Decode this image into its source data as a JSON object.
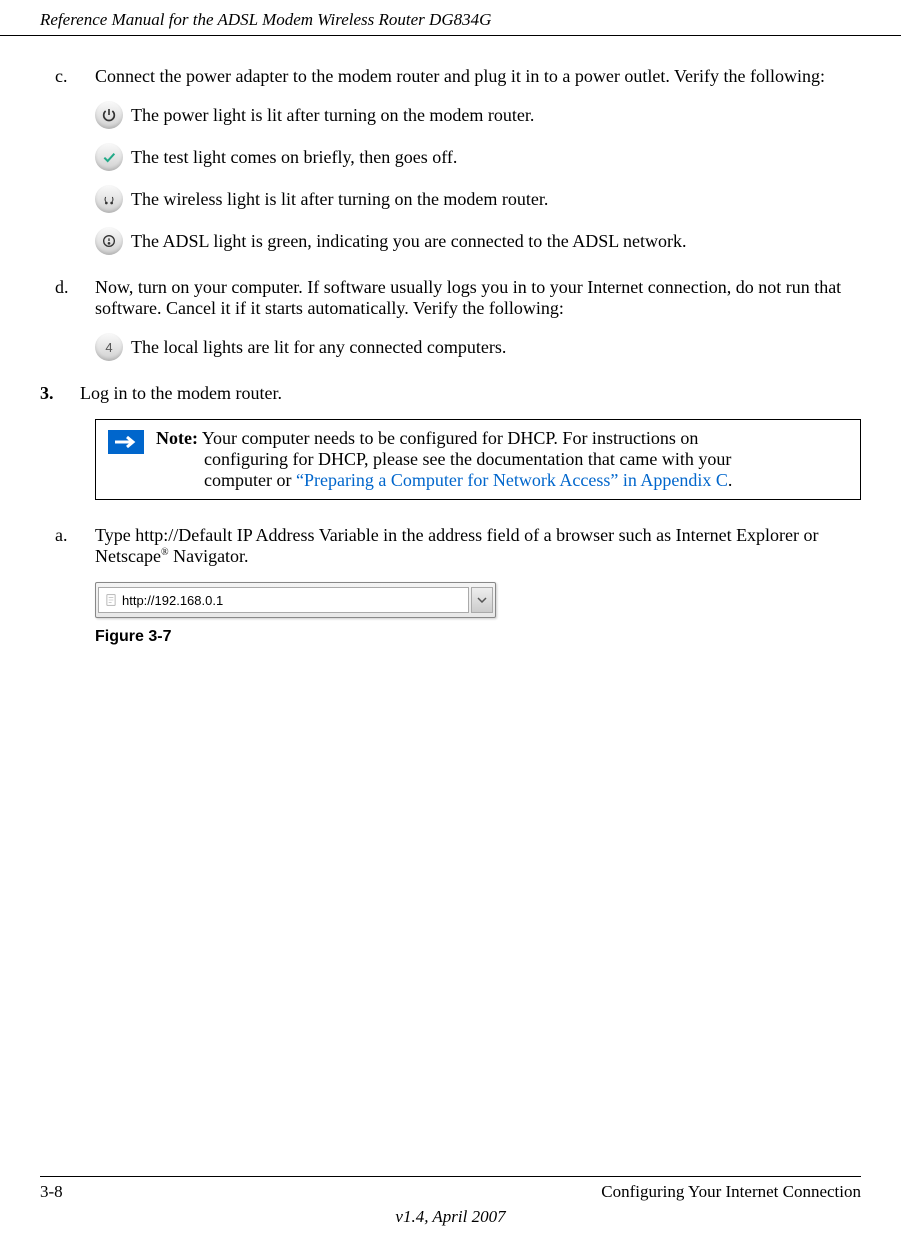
{
  "header": {
    "title": "Reference Manual for the ADSL Modem Wireless Router DG834G"
  },
  "item_c": {
    "marker": "c.",
    "text": "Connect the power adapter to the modem router and plug it in to a power outlet. Verify the following:",
    "bullets": [
      " The power light is lit after turning on the modem router.",
      " The test light comes on briefly, then goes off.",
      " The wireless light is lit after turning on the modem router.",
      " The ADSL light is green, indicating you are connected to the ADSL network."
    ]
  },
  "item_d": {
    "marker": "d.",
    "text": "Now, turn on your computer. If software usually logs you in to your Internet connection, do not run that software. Cancel it if it starts automatically. Verify the following:",
    "bullet": " The local lights are lit for any connected computers."
  },
  "item_3": {
    "marker": "3.",
    "text": "Log in to the modem router."
  },
  "note": {
    "label": "Note:",
    "line1": " Your computer needs to be configured for DHCP. For instructions on",
    "line2": "configuring for DHCP, please see the documentation that came with your",
    "line3_pre": "computer or ",
    "line3_link": "“Preparing a Computer for Network Access” in Appendix C",
    "line3_post": "."
  },
  "item_a": {
    "marker": "a.",
    "text_pre": "Type http://Default IP Address Variable in the address field of a browser such as Internet Explorer or Netscape",
    "reg": "®",
    "text_post": " Navigator."
  },
  "address_bar": {
    "url": "http://192.168.0.1"
  },
  "figure": {
    "caption": "Figure 3-7"
  },
  "footer": {
    "left": "3-8",
    "right": "Configuring Your Internet Connection",
    "center": "v1.4, April 2007"
  },
  "icons": {
    "four": "4"
  }
}
